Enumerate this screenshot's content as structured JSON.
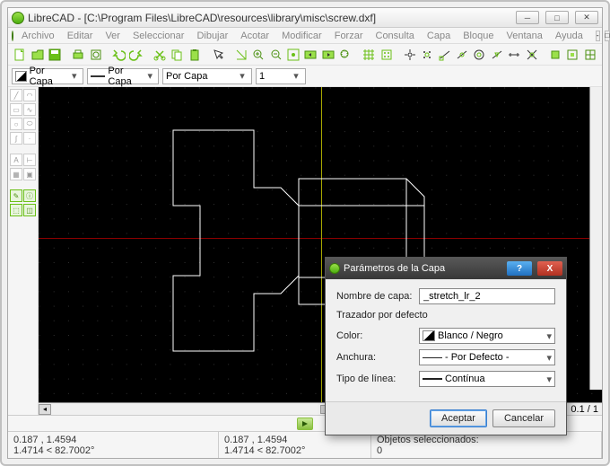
{
  "window": {
    "title": "LibreCAD - [C:\\Program Files\\LibreCAD\\resources\\library\\misc\\screw.dxf]"
  },
  "menu": {
    "items": [
      "Archivo",
      "Editar",
      "Ver",
      "Seleccionar",
      "Dibujar",
      "Acotar",
      "Modificar",
      "Forzar",
      "Consulta",
      "Capa",
      "Bloque",
      "Ventana",
      "Ayuda"
    ]
  },
  "props": {
    "layer": "Por Capa",
    "color": "Por Capa",
    "linetype": "Por Capa",
    "width": "1"
  },
  "zoom": "0.1 / 1",
  "status": {
    "coord1a": "0.187 , 1.4594",
    "coord1b": "1.4714 < 82.7002°",
    "coord2a": "0.187 , 1.4594",
    "coord2b": "1.4714 < 82.7002°",
    "sel_label": "Objetos seleccionados:",
    "sel_count": "0"
  },
  "dialog": {
    "title": "Parámetros de la Capa",
    "name_label": "Nombre de capa:",
    "name_value": "_stretch_lr_2",
    "pen_group": "Trazador por defecto",
    "color_label": "Color:",
    "color_value": "Blanco / Negro",
    "width_label": "Anchura:",
    "width_value": "- Por Defecto -",
    "linetype_label": "Tipo de línea:",
    "linetype_value": "Contínua",
    "ok": "Aceptar",
    "cancel": "Cancelar"
  }
}
